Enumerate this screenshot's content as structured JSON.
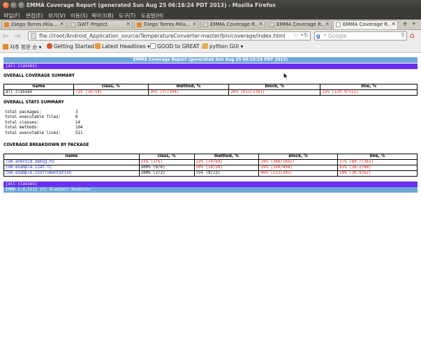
{
  "window": {
    "title": "EMMA Coverage Report (generated Sun Aug 25 06:18:24 PDT 2013) - Mozilla Firefox"
  },
  "menu": [
    "파일(F)",
    "편집(E)",
    "보기(V)",
    "이동(S)",
    "북마크(B)",
    "도구(T)",
    "도움말(H)"
  ],
  "tabs": [
    {
      "label": "Diego Torres Mila...",
      "icon_color": "#e08a2c"
    },
    {
      "label": "GWT Project",
      "icon_color": "#d9d6cf"
    },
    {
      "label": "Diego Torres Mila...",
      "icon_color": "#e08a2c"
    },
    {
      "label": "EMMA Coverage R...",
      "icon_color": "#d9d6cf"
    },
    {
      "label": "EMMA Coverage R...",
      "icon_color": "#d9d6cf"
    },
    {
      "label": "EMMA Coverage R...",
      "icon_color": "#ffffff"
    }
  ],
  "nav": {
    "url": "file:///root/Android_Application_source/TemperatureConverter-master/bin/coverage/index.html",
    "search_placeholder": "Google"
  },
  "bookmarks": [
    {
      "label": "자주 방문 순",
      "icon_color": "#e08a2c"
    },
    {
      "label": "Getting Started",
      "icon_color": "#d8501f"
    },
    {
      "label": "Latest Headlines",
      "icon_color": "#e89a3a"
    },
    {
      "label": "GOOD to GREAT ::",
      "icon_color": "#cfcbc4"
    },
    {
      "label": "python GUI",
      "icon_color": "#e0b050"
    }
  ],
  "report": {
    "header": "EMMA Coverage Report (generated Sun Aug 25 06:18:24 PDT 2013)",
    "all_classes_link": "[all classes]",
    "overall_coverage_title": "OVERALL COVERAGE SUMMARY",
    "columns_overall": [
      "name",
      "class, %",
      "method, %",
      "block, %",
      "line, %"
    ],
    "overall_row": {
      "name": "all classes",
      "class": "71%  (10/14)",
      "method": "36%  (37/104)",
      "block": "26%  (615/2381)",
      "line": "25%  (129.9/511)"
    },
    "stats_title": "OVERALL STATS SUMMARY",
    "stats": [
      {
        "label": "total packages:",
        "value": "3"
      },
      {
        "label": "total executable files:",
        "value": "6"
      },
      {
        "label": "total classes:",
        "value": "14"
      },
      {
        "label": "total methods:",
        "value": "104"
      },
      {
        "label": "total executable lines:",
        "value": "511"
      }
    ],
    "breakdown_title": "COVERAGE BREAKDOWN BY PACKAGE",
    "columns_breakdown": [
      "name",
      "class, %",
      "method, %",
      "block, %",
      "line, %"
    ],
    "packages": [
      {
        "name": "com.android.debug.hv",
        "class": "33%  (2/6)",
        "class_red": true,
        "method": "22%  (14/64)",
        "method_red": true,
        "block": "19%  (308/1642)",
        "block_red": true,
        "line": "17%  (60.7/361)",
        "line_red": true
      },
      {
        "name": "com.example.i2at.tc",
        "class": "100% (6/6)",
        "class_red": false,
        "method": "50%  (14/28)",
        "method_red": true,
        "block": "39%  (194/494)",
        "block_red": true,
        "line": "43%  (38.2/88)",
        "line_red": true
      },
      {
        "name": "com.example.instrumentation",
        "class": "100% (2/2)",
        "class_red": false,
        "method": "75%  (9/12)",
        "method_red": false,
        "block": "46%  (113/245)",
        "block_red": true,
        "line": "50%  (30.9/62)",
        "line_red": true
      }
    ],
    "footer": "EMMA 2.0.5312 (C) Vladimir Roubtsov"
  }
}
